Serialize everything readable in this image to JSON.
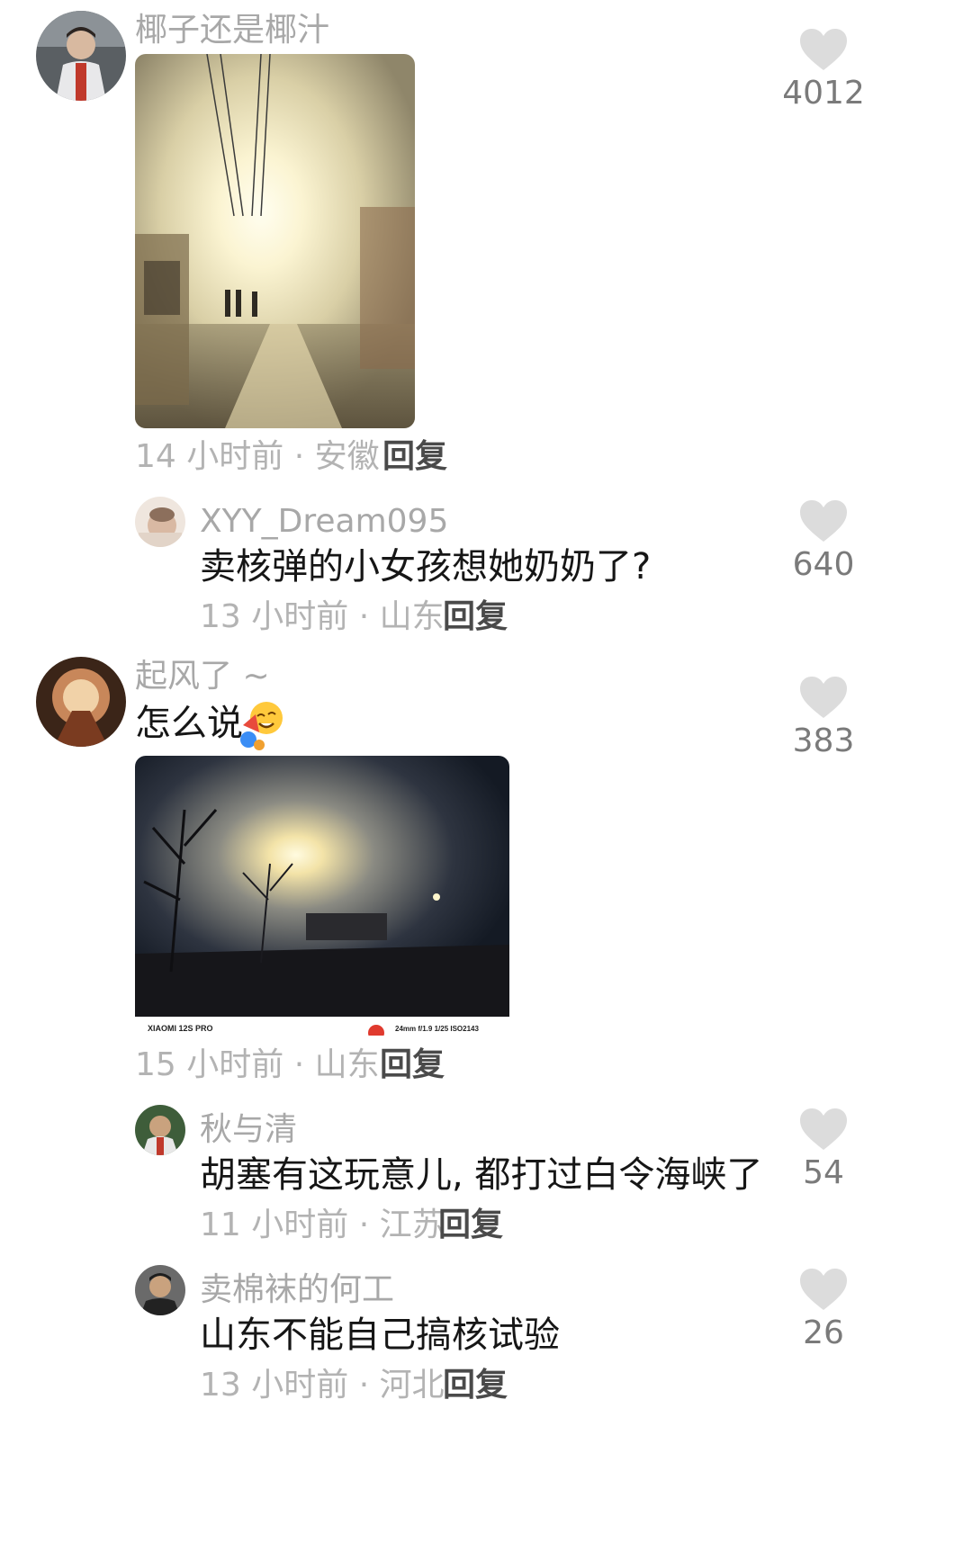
{
  "comments": [
    {
      "username": "椰子还是椰汁",
      "meta": "14 小时前 · 安徽",
      "reply": "回复",
      "likes": "4012",
      "avatar_icon": "user-avatar-icon",
      "image": "night-street-glow-photo"
    },
    {
      "username": "XYY_Dream095",
      "text": "卖核弹的小女孩想她奶奶了?",
      "meta": "13 小时前 · 山东",
      "reply": "回复",
      "likes": "640",
      "avatar_icon": "user-avatar-icon"
    },
    {
      "username": "起风了 ~",
      "text": "怎么说",
      "meta": "15 小时前 · 山东",
      "reply": "回复",
      "likes": "383",
      "avatar_icon": "user-avatar-icon",
      "emoji_icon": "laughing-clown-emoji-icon",
      "image": "night-sky-glow-photo",
      "image_caption": {
        "camera": "XIAOMI 12S PRO",
        "exif": "24mm  f/1.9  1/25  ISO2143"
      }
    },
    {
      "username": "秋与清",
      "text": "胡塞有这玩意儿, 都打过白令海峡了",
      "meta": "11 小时前 · 江苏",
      "reply": "回复",
      "likes": "54",
      "avatar_icon": "user-avatar-icon"
    },
    {
      "username": "卖棉袜的何工",
      "text": "山东不能自己搞核试验",
      "meta": "13 小时前 · 河北",
      "reply": "回复",
      "likes": "26",
      "avatar_icon": "user-avatar-icon"
    }
  ],
  "colors": {
    "username": "#a8a8a8",
    "text": "#161616",
    "meta": "#b3b3b3",
    "heart": "#dcdcdc"
  }
}
